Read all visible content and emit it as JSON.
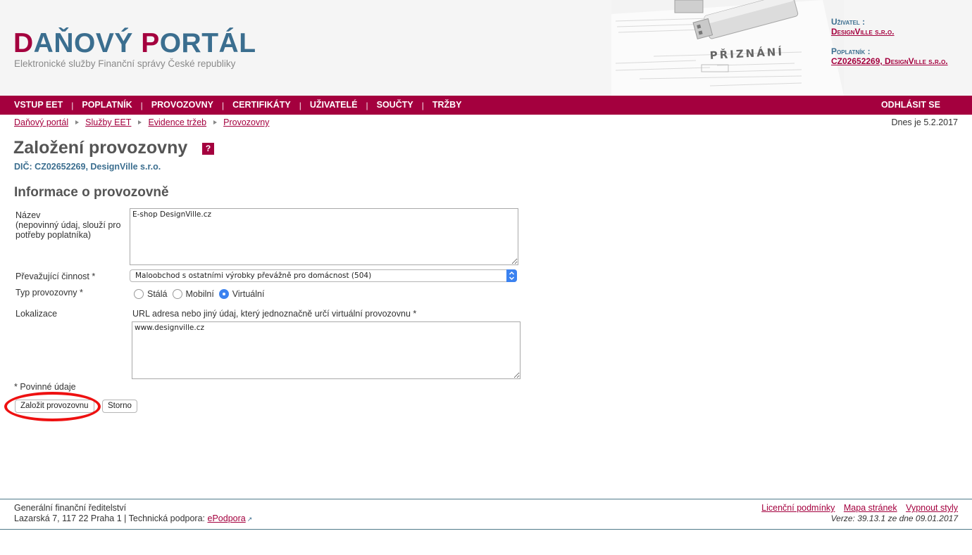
{
  "header": {
    "logo_first_letter_1": "D",
    "logo_rest_1": "AŇOVÝ ",
    "logo_first_letter_2": "P",
    "logo_rest_2": "ORTÁL",
    "tagline": "Elektronické služby Finanční správy České republiky",
    "art_caption": "PŘIZNÁNÍ",
    "user_label": "Uživatel :",
    "user_value": "DesignVille s.r.o.",
    "taxpayer_label": "Poplatník :",
    "taxpayer_value": "CZ02652269, DesignVille s.r.o."
  },
  "nav": {
    "items": [
      "VSTUP EET",
      "POPLATNÍK",
      "PROVOZOVNY",
      "CERTIFIKÁTY",
      "UŽIVATELÉ",
      "SOUČTY",
      "TRŽBY"
    ],
    "separator": "|",
    "logout": "ODHLÁSIT SE"
  },
  "breadcrumb": [
    "Daňový portál",
    "Služby EET",
    "Evidence tržeb",
    "Provozovny"
  ],
  "today": "Dnes je 5.2.2017",
  "page": {
    "title": "Založení provozovny",
    "help": "?",
    "dic": "DIČ: CZ02652269, DesignVille s.r.o.",
    "section_title": "Informace o provozovně"
  },
  "form": {
    "name_label": "Název",
    "name_hint": "(nepovinný údaj, slouží pro potřeby poplatníka)",
    "name_value": "E-shop DesignVille.cz",
    "activity_label": "Převažující činnost *",
    "activity_value": "Maloobchod s ostatními výrobky převážně pro domácnost (504)",
    "type_label": "Typ provozovny *",
    "type_options": [
      "Stálá",
      "Mobilní",
      "Virtuální"
    ],
    "type_selected": "Virtuální",
    "location_label": "Lokalizace",
    "location_hint": "URL adresa nebo jiný údaj, který jednoznačně určí virtuální provozovnu *",
    "location_value": "www.designville.cz",
    "required_note": "* Povinné údaje",
    "create_button": "Založit provozovnu",
    "cancel_button": "Storno"
  },
  "footer": {
    "org": "Generální finanční ředitelství",
    "address": "Lazarská 7, 117 22 Praha 1 | Technická podpora:",
    "support_link": "ePodpora",
    "links": [
      "Licenční podmínky",
      "Mapa stránek",
      "Vypnout styly"
    ],
    "version": "Verze: 39.13.1 ze dne 09.01.2017"
  },
  "colors": {
    "brand": "#a4003e",
    "secondary": "#3b6e8f",
    "highlight": "#ee1111"
  }
}
